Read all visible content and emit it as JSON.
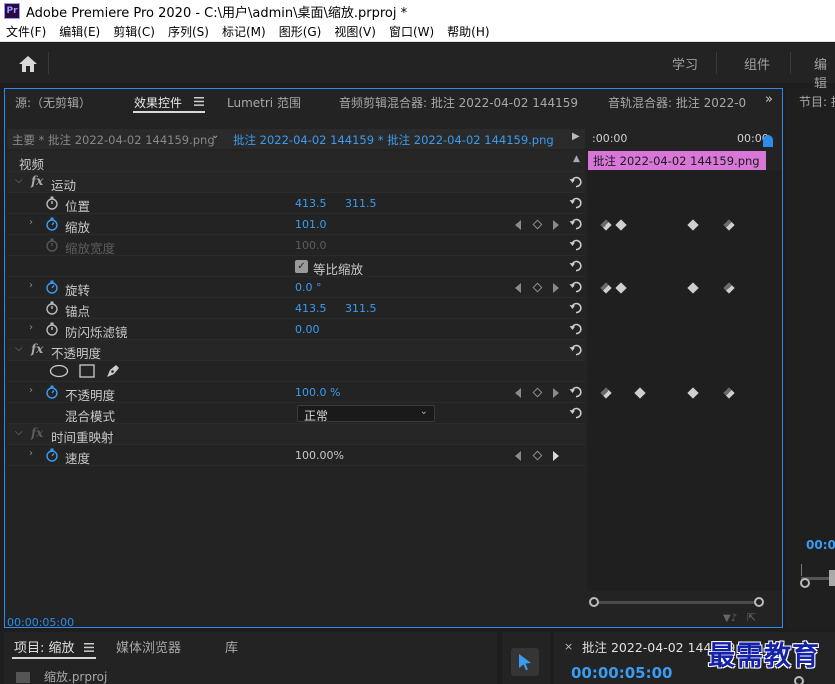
{
  "window": {
    "title": "Adobe Premiere Pro 2020 - C:\\用户\\admin\\桌面\\缩放.prproj *",
    "logo": "Pr"
  },
  "menu": [
    "文件(F)",
    "编辑(E)",
    "剪辑(C)",
    "序列(S)",
    "标记(M)",
    "图形(G)",
    "视图(V)",
    "窗口(W)",
    "帮助(H)"
  ],
  "workspaces": {
    "learn": "学习",
    "assembly": "组件",
    "editing": "编辑"
  },
  "panel_tabs": {
    "source": "源:（无剪辑）",
    "effect_controls": "效果控件",
    "lumetri": "Lumetri 范围",
    "audio_clip_mixer": "音频剪辑混合器: 批注 2022-04-02 144159",
    "audio_track_mixer": "音轨混合器: 批注 2022-0",
    "more": "»"
  },
  "clip_bar": {
    "master": "主要 * 批注 2022-04-02  144159.png",
    "clip": "批注 2022-04-02  144159 * 批注 2022-04-02  144159.png"
  },
  "timeline": {
    "start": ":00:00",
    "end": "00:00",
    "clip_name": "批注 2022-04-02  144159.png"
  },
  "effects": {
    "video_header": "视频",
    "motion": {
      "label": "运动",
      "position": {
        "label": "位置",
        "x": "413.5",
        "y": "311.5"
      },
      "scale": {
        "label": "缩放",
        "value": "101.0"
      },
      "scale_width": {
        "label": "缩放宽度",
        "value": "100.0"
      },
      "uniform_scale": {
        "label": "等比缩放",
        "checked": true
      },
      "rotation": {
        "label": "旋转",
        "value": "0.0 °"
      },
      "anchor": {
        "label": "锚点",
        "x": "413.5",
        "y": "311.5"
      },
      "anti_flicker": {
        "label": "防闪烁滤镜",
        "value": "0.00"
      }
    },
    "opacity": {
      "label": "不透明度",
      "opacity": {
        "label": "不透明度",
        "value": "100.0 %"
      },
      "blend_mode": {
        "label": "混合模式",
        "value": "正常"
      }
    },
    "time_remap": {
      "label": "时间重映射",
      "speed": {
        "label": "速度",
        "value": "100.00%"
      }
    }
  },
  "panel_time": "00:00:05:00",
  "program": {
    "tab": "节目: 批",
    "time": "00:0"
  },
  "bottom": {
    "project_tab": "项目: 缩放",
    "media_tab": "媒体浏览器",
    "library_tab": "库",
    "project_file": "缩放.prproj",
    "timeline_close": "×",
    "timeline_tab": "批注 2022-04-02  144159",
    "timeline_tc": "00:00:05:00"
  },
  "watermark": "最需教育",
  "colors": {
    "accent": "#2d8ceb",
    "value_blue": "#3a9cf0",
    "clip_pink": "#d877d8"
  }
}
